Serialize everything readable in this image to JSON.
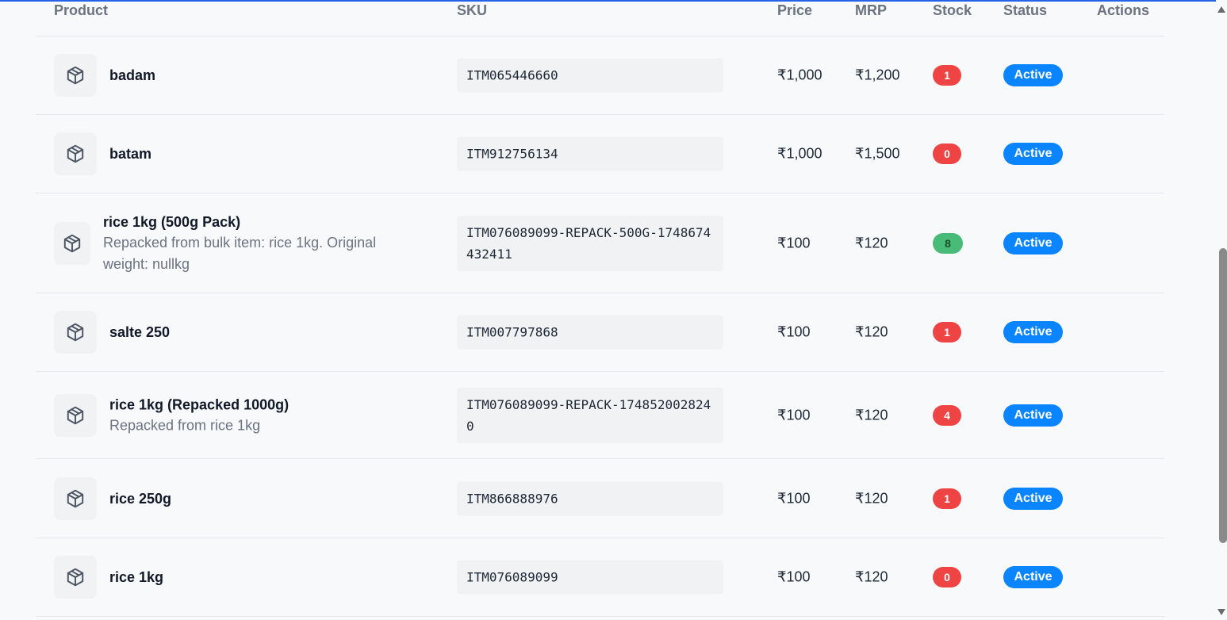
{
  "table": {
    "headers": {
      "product": "Product",
      "sku": "SKU",
      "price": "Price",
      "mrp": "MRP",
      "stock": "Stock",
      "status": "Status",
      "actions": "Actions"
    },
    "rows": [
      {
        "name": "badam",
        "desc": "",
        "sku": "ITM065446660",
        "price": "₹1,000",
        "mrp": "₹1,200",
        "stock": "1",
        "stock_color": "#ef4444",
        "status": "Active"
      },
      {
        "name": "batam",
        "desc": "",
        "sku": "ITM912756134",
        "price": "₹1,000",
        "mrp": "₹1,500",
        "stock": "0",
        "stock_color": "#ef4444",
        "status": "Active"
      },
      {
        "name": "rice 1kg (500g Pack)",
        "desc": "Repacked from bulk item: rice 1kg. Original weight: nullkg",
        "sku": "ITM076089099-REPACK-500G-1748674432411",
        "price": "₹100",
        "mrp": "₹120",
        "stock": "8",
        "stock_color": "#48bb78",
        "status": "Active"
      },
      {
        "name": "salte 250",
        "desc": "",
        "sku": "ITM007797868",
        "price": "₹100",
        "mrp": "₹120",
        "stock": "1",
        "stock_color": "#ef4444",
        "status": "Active"
      },
      {
        "name": "rice 1kg (Repacked 1000g)",
        "desc": "Repacked from rice 1kg",
        "sku": "ITM076089099-REPACK-1748520028240",
        "price": "₹100",
        "mrp": "₹120",
        "stock": "4",
        "stock_color": "#ef4444",
        "status": "Active"
      },
      {
        "name": "rice 250g",
        "desc": "",
        "sku": "ITM866888976",
        "price": "₹100",
        "mrp": "₹120",
        "stock": "1",
        "stock_color": "#ef4444",
        "status": "Active"
      },
      {
        "name": "rice 1kg",
        "desc": "",
        "sku": "ITM076089099",
        "price": "₹100",
        "mrp": "₹120",
        "stock": "0",
        "stock_color": "#ef4444",
        "status": "Active"
      }
    ]
  },
  "colors": {
    "accent": "#0a84ff",
    "stock_low": "#ef4444",
    "stock_ok": "#48bb78",
    "top_border": "#2563eb"
  },
  "icons": {
    "product": "package-icon"
  }
}
